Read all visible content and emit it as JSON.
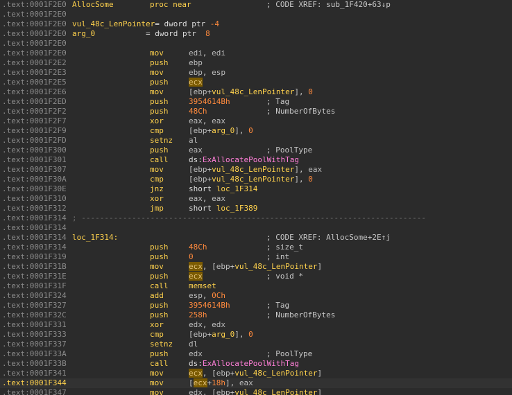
{
  "prefix": ".text:",
  "rows": [
    {
      "addr": "0001F2E0",
      "label": "AllocSome",
      "label_right": "proc near",
      "comment": "; CODE XREF: sub_1F420+63↓p"
    },
    {
      "addr": "0001F2E0"
    },
    {
      "addr": "0001F2E0",
      "var": "vul_48c_LenPointer",
      "decl": "= dword ptr -4"
    },
    {
      "addr": "0001F2E0",
      "var": "arg_0",
      "decl": "= dword ptr  8"
    },
    {
      "addr": "0001F2E0"
    },
    {
      "addr": "0001F2E0",
      "mnem": "mov",
      "ops": "edi, edi"
    },
    {
      "addr": "0001F2E2",
      "mnem": "push",
      "ops": "ebp"
    },
    {
      "addr": "0001F2E3",
      "mnem": "mov",
      "ops": "ebp, esp"
    },
    {
      "addr": "0001F2E5",
      "mnem": "push",
      "ops": "ecx"
    },
    {
      "addr": "0001F2E6",
      "mnem": "mov",
      "ops": "[ebp+vul_48c_LenPointer], 0"
    },
    {
      "addr": "0001F2ED",
      "mnem": "push",
      "ops": "3954614Bh",
      "comment": "; Tag"
    },
    {
      "addr": "0001F2F2",
      "mnem": "push",
      "ops": "48Ch",
      "comment": "; NumberOfBytes"
    },
    {
      "addr": "0001F2F7",
      "mnem": "xor",
      "ops": "eax, eax"
    },
    {
      "addr": "0001F2F9",
      "mnem": "cmp",
      "ops": "[ebp+arg_0], 0"
    },
    {
      "addr": "0001F2FD",
      "mnem": "setnz",
      "ops": "al"
    },
    {
      "addr": "0001F300",
      "mnem": "push",
      "ops": "eax",
      "comment": "; PoolType"
    },
    {
      "addr": "0001F301",
      "mnem": "call",
      "ops": "ds:ExAllocatePoolWithTag"
    },
    {
      "addr": "0001F307",
      "mnem": "mov",
      "ops": "[ebp+vul_48c_LenPointer], eax"
    },
    {
      "addr": "0001F30A",
      "mnem": "cmp",
      "ops": "[ebp+vul_48c_LenPointer], 0"
    },
    {
      "addr": "0001F30E",
      "mnem": "jnz",
      "ops": "short loc_1F314"
    },
    {
      "addr": "0001F310",
      "mnem": "xor",
      "ops": "eax, eax"
    },
    {
      "addr": "0001F312",
      "mnem": "jmp",
      "ops": "short loc_1F389"
    },
    {
      "addr": "0001F314",
      "sep": "; ---------------------------------------------------------------------------"
    },
    {
      "addr": "0001F314"
    },
    {
      "addr": "0001F314",
      "label": "loc_1F314:",
      "comment": "; CODE XREF: AllocSome+2E↑j"
    },
    {
      "addr": "0001F314",
      "mnem": "push",
      "ops": "48Ch",
      "comment": "; size_t"
    },
    {
      "addr": "0001F319",
      "mnem": "push",
      "ops": "0",
      "comment": "; int"
    },
    {
      "addr": "0001F31B",
      "mnem": "mov",
      "ops": "ecx, [ebp+vul_48c_LenPointer]"
    },
    {
      "addr": "0001F31E",
      "mnem": "push",
      "ops": "ecx",
      "comment": "; void *"
    },
    {
      "addr": "0001F31F",
      "mnem": "call",
      "ops": "memset"
    },
    {
      "addr": "0001F324",
      "mnem": "add",
      "ops": "esp, 0Ch"
    },
    {
      "addr": "0001F327",
      "mnem": "push",
      "ops": "3954614Bh",
      "comment": "; Tag"
    },
    {
      "addr": "0001F32C",
      "mnem": "push",
      "ops": "258h",
      "comment": "; NumberOfBytes"
    },
    {
      "addr": "0001F331",
      "mnem": "xor",
      "ops": "edx, edx"
    },
    {
      "addr": "0001F333",
      "mnem": "cmp",
      "ops": "[ebp+arg_0], 0"
    },
    {
      "addr": "0001F337",
      "mnem": "setnz",
      "ops": "dl"
    },
    {
      "addr": "0001F33A",
      "mnem": "push",
      "ops": "edx",
      "comment": "; PoolType"
    },
    {
      "addr": "0001F33B",
      "mnem": "call",
      "ops": "ds:ExAllocatePoolWithTag"
    },
    {
      "addr": "0001F341",
      "mnem": "mov",
      "ops": "ecx, [ebp+vul_48c_LenPointer]"
    },
    {
      "addr": "0001F344",
      "mnem": "mov",
      "ops": "[ecx+18h], eax",
      "current": true
    },
    {
      "addr": "0001F347",
      "mnem": "mov",
      "ops": "edx, [ebp+vul_48c_LenPointer]"
    }
  ]
}
